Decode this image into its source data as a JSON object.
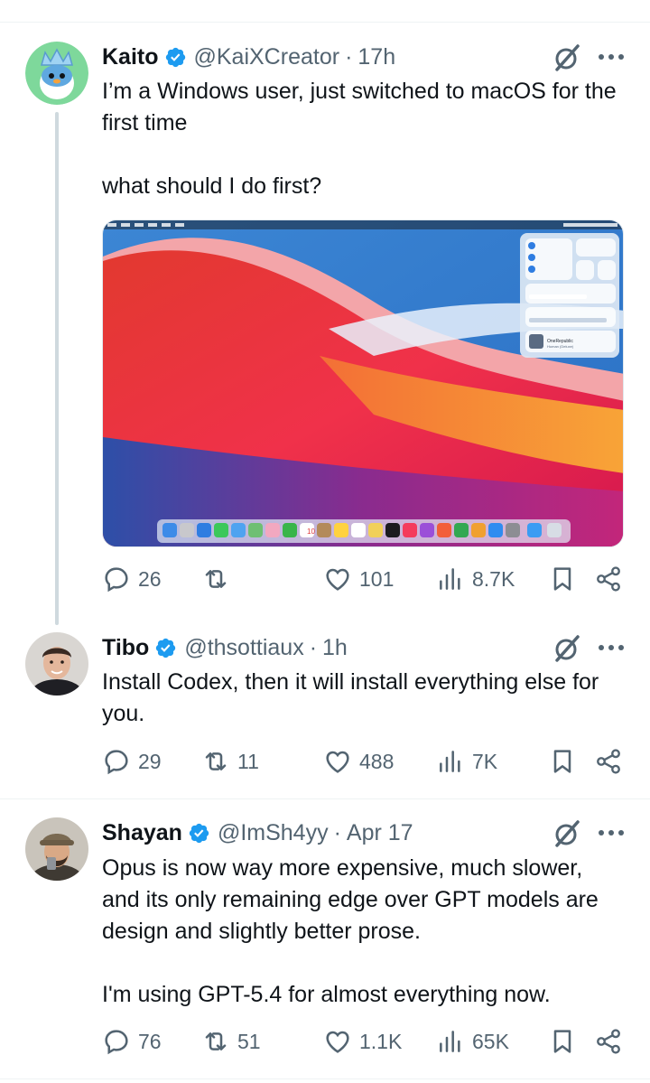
{
  "tweets": [
    {
      "name": "Kaito",
      "handle": "@KaiXCreator",
      "separator": "·",
      "time": "17h",
      "lines": [
        "I’m a Windows user, just switched to macOS for the first time",
        "what should I do first?"
      ],
      "replies": "26",
      "reposts": "",
      "likes": "101",
      "views": "8.7K"
    },
    {
      "name": "Tibo",
      "handle": "@thsottiaux",
      "separator": "·",
      "time": "1h",
      "lines": [
        "Install Codex, then it will install everything else for you."
      ],
      "replies": "29",
      "reposts": "11",
      "likes": "488",
      "views": "7K"
    },
    {
      "name": "Shayan",
      "handle": "@ImSh4yy",
      "separator": "·",
      "time": "Apr 17",
      "lines": [
        "Opus is now way more expensive, much slower, and its only remaining edge over GPT models are design and slightly better prose.",
        "I'm using GPT-5.4 for almost everything now."
      ],
      "replies": "76",
      "reposts": "51",
      "likes": "1.1K",
      "views": "65K"
    }
  ],
  "media": {
    "dock_date": "10",
    "now_playing_title": "OneRepublic",
    "now_playing_subtitle": "Human (Deluxe)"
  },
  "colors": {
    "verified": "#1d9bf0",
    "text": "#0f1419",
    "muted": "#536471",
    "thread_line": "#cfd9de"
  },
  "icons": [
    "verified-badge-icon",
    "grok-icon",
    "more-icon",
    "reply-icon",
    "repost-icon",
    "like-icon",
    "views-icon",
    "bookmark-icon",
    "share-icon"
  ]
}
